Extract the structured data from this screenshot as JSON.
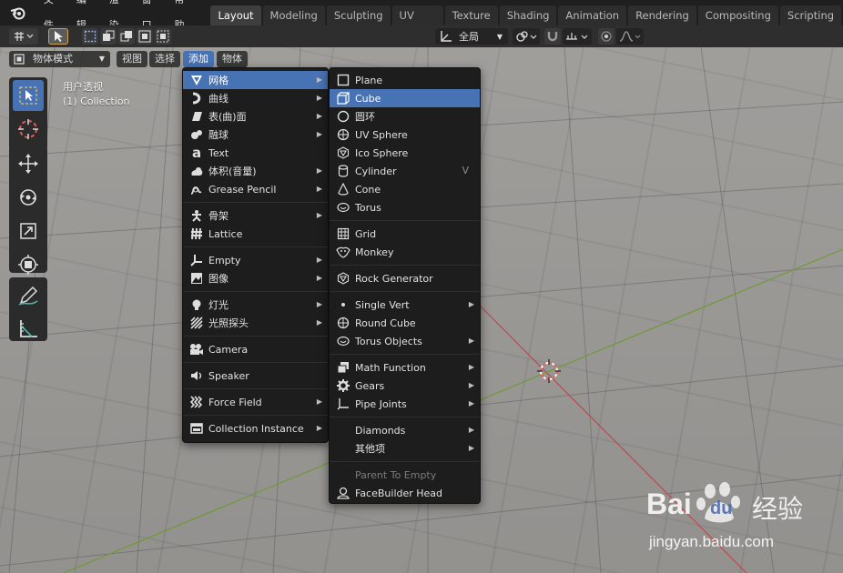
{
  "topbar": {
    "menus": [
      "文件",
      "编辑",
      "渲染",
      "窗口",
      "帮助"
    ],
    "workspaces": [
      "Layout",
      "Modeling",
      "Sculpting",
      "UV Editing",
      "Texture Paint",
      "Shading",
      "Animation",
      "Rendering",
      "Compositing",
      "Scripting"
    ],
    "active_workspace": "Layout"
  },
  "header": {
    "orientation": "全局"
  },
  "viewport_header": {
    "mode": "物体模式",
    "menus": [
      "视图",
      "选择",
      "添加",
      "物体"
    ],
    "active_menu": "添加"
  },
  "overlay": {
    "view_name": "用户透视",
    "collection": "(1) Collection"
  },
  "add_menu": {
    "items": [
      {
        "label": "网格",
        "icon": "mesh-icon",
        "submenu": true,
        "highlighted": true
      },
      {
        "label": "曲线",
        "icon": "curve-icon",
        "submenu": true
      },
      {
        "label": "表(曲)面",
        "icon": "surface-icon",
        "submenu": true
      },
      {
        "label": "融球",
        "icon": "metaball-icon",
        "submenu": true
      },
      {
        "label": "Text",
        "icon": "text-icon",
        "submenu": false
      },
      {
        "label": "体积(音量)",
        "icon": "volume-icon",
        "submenu": true
      },
      {
        "label": "Grease Pencil",
        "icon": "grease-pencil-icon",
        "submenu": true
      },
      {
        "label": "骨架",
        "icon": "armature-icon",
        "submenu": true
      },
      {
        "label": "Lattice",
        "icon": "lattice-icon",
        "submenu": false
      },
      {
        "label": "Empty",
        "icon": "empty-icon",
        "submenu": true
      },
      {
        "label": "图像",
        "icon": "image-icon",
        "submenu": true
      },
      {
        "label": "灯光",
        "icon": "light-icon",
        "submenu": true
      },
      {
        "label": "光照探头",
        "icon": "light-probe-icon",
        "submenu": true
      },
      {
        "label": "Camera",
        "icon": "camera-icon",
        "submenu": false
      },
      {
        "label": "Speaker",
        "icon": "speaker-icon",
        "submenu": false
      },
      {
        "label": "Force Field",
        "icon": "force-field-icon",
        "submenu": true
      },
      {
        "label": "Collection Instance",
        "icon": "collection-instance-icon",
        "submenu": true
      }
    ]
  },
  "mesh_menu": {
    "items": [
      {
        "label": "Plane",
        "icon": "plane-icon"
      },
      {
        "label": "Cube",
        "icon": "cube-icon",
        "highlighted": true
      },
      {
        "label": "圆环",
        "icon": "circle-icon"
      },
      {
        "label": "UV Sphere",
        "icon": "uv-sphere-icon"
      },
      {
        "label": "Ico Sphere",
        "icon": "ico-sphere-icon"
      },
      {
        "label": "Cylinder",
        "icon": "cylinder-icon",
        "shortcut": "V"
      },
      {
        "label": "Cone",
        "icon": "cone-icon"
      },
      {
        "label": "Torus",
        "icon": "torus-icon"
      },
      {
        "label": "Grid",
        "icon": "grid-icon"
      },
      {
        "label": "Monkey",
        "icon": "monkey-icon"
      },
      {
        "label": "Rock Generator",
        "icon": "rock-icon"
      },
      {
        "label": "Single Vert",
        "icon": "vertex-icon",
        "submenu": true
      },
      {
        "label": "Round Cube",
        "icon": "round-cube-icon"
      },
      {
        "label": "Torus Objects",
        "icon": "torus-objects-icon",
        "submenu": true
      },
      {
        "label": "Math Function",
        "icon": "math-function-icon",
        "submenu": true
      },
      {
        "label": "Gears",
        "icon": "gears-icon",
        "submenu": true
      },
      {
        "label": "Pipe Joints",
        "icon": "pipe-joints-icon",
        "submenu": true
      },
      {
        "label": "Diamonds",
        "icon": "",
        "submenu": true
      },
      {
        "label": "其他项",
        "icon": "",
        "submenu": true
      },
      {
        "label": "Parent To Empty",
        "icon": "",
        "disabled": true
      },
      {
        "label": "FaceBuilder Head",
        "icon": "facebuilder-icon"
      }
    ]
  },
  "colors": {
    "highlight": "#4772b3",
    "menu_bg": "#1d1d1d",
    "x_axis": "#c0474a",
    "y_axis": "#6e9a34"
  },
  "watermark": {
    "brand": "Bai",
    "brand2": "du",
    "suffix": "经验",
    "url": "jingyan.baidu.com"
  }
}
